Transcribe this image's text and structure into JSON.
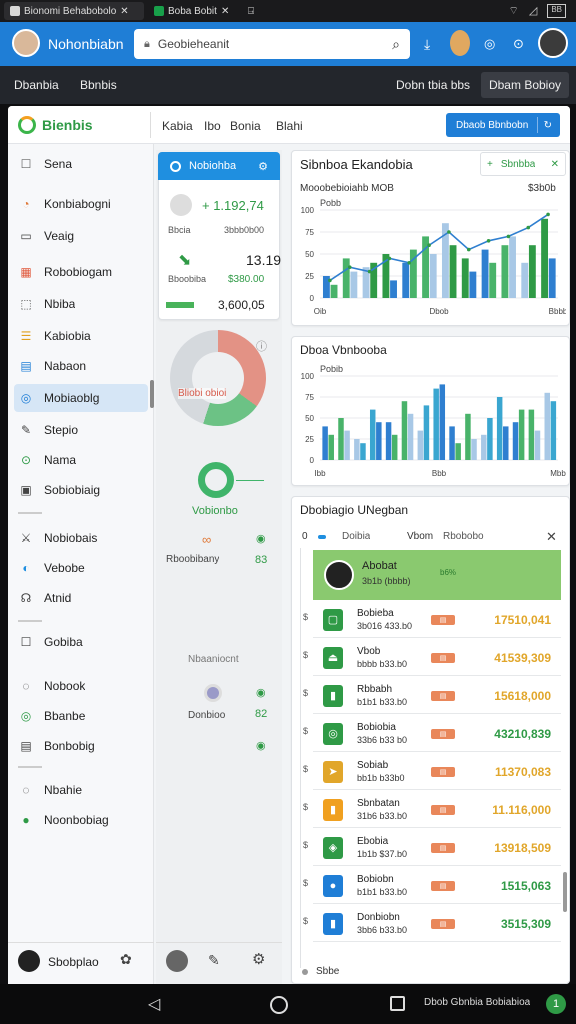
{
  "tabs": [
    {
      "label": "Bionomi Behabobolo",
      "color": "#d8d8d8"
    },
    {
      "label": "Boba Bobit",
      "color": "#18a04a"
    },
    {
      "label": "",
      "color": ""
    }
  ],
  "status_right": "BB",
  "app": {
    "name": "Nohonbiabn",
    "search_placeholder": "Geobieheanit"
  },
  "darkbar": {
    "left1": "Dbanbia",
    "left2": "Bbnbis",
    "right1": "Dobn tbia bbs",
    "right2": "Dbam Bobioy"
  },
  "header": {
    "brand": "Bienbis",
    "nav": [
      "Kabia",
      "Ibo",
      "Bonia",
      "Blahi"
    ],
    "action": "Dbaob Bbnbobn"
  },
  "sidebar": {
    "items": [
      "Sena",
      "Konbiabogni",
      "Veaig",
      "Robobiogam",
      "Nbiba",
      "Kabiobia",
      "Nabaon",
      "Mobiaoblg",
      "Stepio",
      "Nama",
      "Sobiobiaig",
      "Nobiobais",
      "Vebobe",
      "Atnid",
      "Gobiba",
      "Nobook",
      "Bbanbe",
      "Bonbobig",
      "Nbahie",
      "Noonbobiag"
    ],
    "footer": "Sbobplao",
    "active_index": 7
  },
  "mid": {
    "tab": "Nobiohba",
    "big_val": "+ 1.192,74",
    "label1": "Bbcia",
    "val2": "3bbb0b00",
    "val3": "13.19",
    "label3": "Bboobiba",
    "val3b": "$380.00",
    "val4": "3,600,05",
    "donut_label": "Bliobi obioi",
    "circle_label": "Vobionbo",
    "label5": "Rboobibany",
    "val5": "83",
    "label6": "Nbaaniocnt",
    "label7": "Donbioo",
    "val7": "82"
  },
  "chart1": {
    "title": "Sibnboa Ekandobia",
    "button": "Sbnbba",
    "sublabel": "Mooobebioiahb MOB",
    "subright": "$3b0b",
    "legend": "Pobb",
    "xlabels": [
      "Oib",
      "Dbob",
      "Bbbb"
    ]
  },
  "chart2": {
    "title": "Dboa Vbnbooba",
    "legend": "Pobib",
    "xlabels": [
      "Ibb",
      "Bbb",
      "Mbb"
    ]
  },
  "list": {
    "title": "Dbobiagio UNegban",
    "col1": "Doibia",
    "col2": "Vbom",
    "col3": "Rbobobo",
    "feature": {
      "title": "Abobat",
      "sub": "3b1b (bbbb)",
      "pct": "b6%"
    },
    "rows": [
      {
        "t1": "Bobieba",
        "t2": "3b016  433.b0",
        "amt": "17510,041",
        "color": "#2f9a46",
        "amtcolor": "#e1a62a"
      },
      {
        "t1": "Vbob",
        "t2": "bbbb  b33.b0",
        "amt": "41539,309",
        "color": "#2f9a46",
        "amtcolor": "#e1a62a"
      },
      {
        "t1": "Rbbabh",
        "t2": "b1b1  b33.b0",
        "amt": "15618,000",
        "color": "#2f9a46",
        "amtcolor": "#e1a62a"
      },
      {
        "t1": "Bobiobia",
        "t2": "33b6  b33 b0",
        "amt": "43210,839",
        "color": "#2f9a46",
        "amtcolor": "#2f9a46"
      },
      {
        "t1": "Sobiab",
        "t2": "bb1b  b33b0",
        "amt": "11370,083",
        "color": "#e1a62a",
        "amtcolor": "#e1a62a"
      },
      {
        "t1": "Sbnbatan",
        "t2": "31b6  b33.b0",
        "amt": "11.116,000",
        "color": "#f0a020",
        "amtcolor": "#e1a62a"
      },
      {
        "t1": "Ebobia",
        "t2": "1b1b  $37.b0",
        "amt": "13918,509",
        "color": "#2f9a46",
        "amtcolor": "#e1a62a"
      },
      {
        "t1": "Bobiobn",
        "t2": "b1b1  b33.b0",
        "amt": "1515,063",
        "color": "#1f7ed6",
        "amtcolor": "#2f9a46"
      },
      {
        "t1": "Donbiobn",
        "t2": "3bb6  b33.b0",
        "amt": "3515,309",
        "color": "#1f7ed6",
        "amtcolor": "#2f9a46"
      }
    ],
    "footer": "Sbbe"
  },
  "chart_data": [
    {
      "type": "bar",
      "title": "Sibnboa Ekandobia",
      "categories": [
        "1",
        "2",
        "3",
        "4",
        "5",
        "6",
        "7",
        "8",
        "9",
        "10",
        "11",
        "12"
      ],
      "series": [
        {
          "name": "",
          "values": [
            25,
            45,
            35,
            50,
            40,
            70,
            85,
            45,
            55,
            60,
            40,
            90
          ]
        },
        {
          "name": "",
          "values": [
            15,
            30,
            40,
            20,
            55,
            50,
            60,
            30,
            40,
            70,
            60,
            45
          ]
        }
      ],
      "line": [
        20,
        35,
        30,
        45,
        40,
        60,
        75,
        55,
        65,
        70,
        80,
        95
      ],
      "ylim": [
        0,
        100
      ]
    },
    {
      "type": "bar",
      "title": "Dboa Vbnbooba",
      "categories": [
        "1",
        "2",
        "3",
        "4",
        "5",
        "6",
        "7",
        "8",
        "9",
        "10",
        "11",
        "12",
        "13",
        "14",
        "15"
      ],
      "series": [
        {
          "name": "",
          "values": [
            40,
            50,
            25,
            60,
            45,
            70,
            35,
            85,
            40,
            55,
            30,
            75,
            45,
            60,
            80
          ]
        },
        {
          "name": "",
          "values": [
            30,
            35,
            20,
            45,
            30,
            55,
            65,
            90,
            20,
            25,
            50,
            40,
            60,
            35,
            70
          ]
        }
      ],
      "ylim": [
        0,
        100
      ]
    }
  ]
}
